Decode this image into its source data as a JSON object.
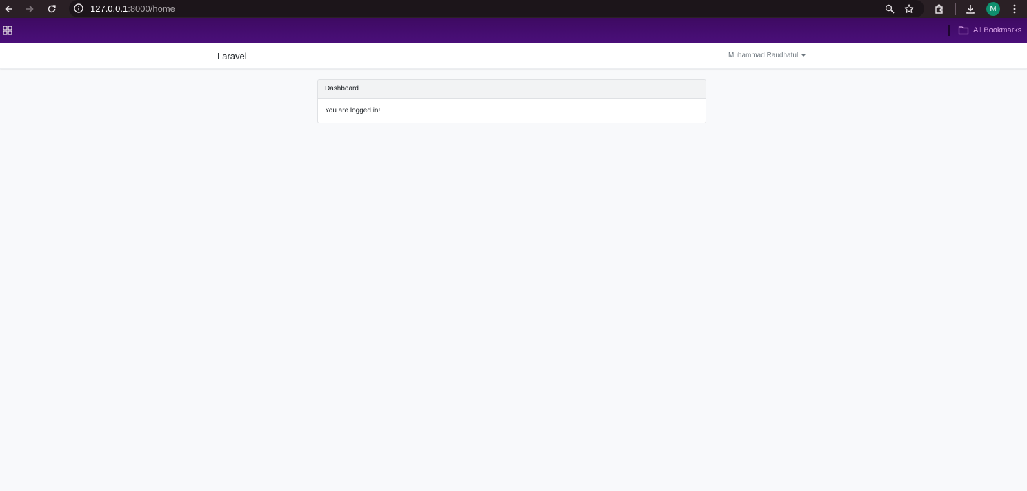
{
  "browser": {
    "url_host": "127.0.0.1",
    "url_rest": ":8000/home",
    "profile_initial": "M",
    "icons": [
      "back-icon",
      "forward-icon",
      "reload-icon",
      "site-info-icon",
      "zoom-icon",
      "bookmark-star-icon",
      "extensions-icon",
      "download-icon",
      "menu-icon"
    ]
  },
  "bookmarks": {
    "all_bookmarks_label": "All Bookmarks"
  },
  "navbar": {
    "brand": "Laravel",
    "user_name": "Muhammad Raudhatul"
  },
  "card": {
    "header": "Dashboard",
    "body": "You are logged in!"
  },
  "colors": {
    "bookmarks_bar": "#4a0f7a",
    "page_background": "#f8f9fb",
    "avatar": "#0f8f6e"
  }
}
